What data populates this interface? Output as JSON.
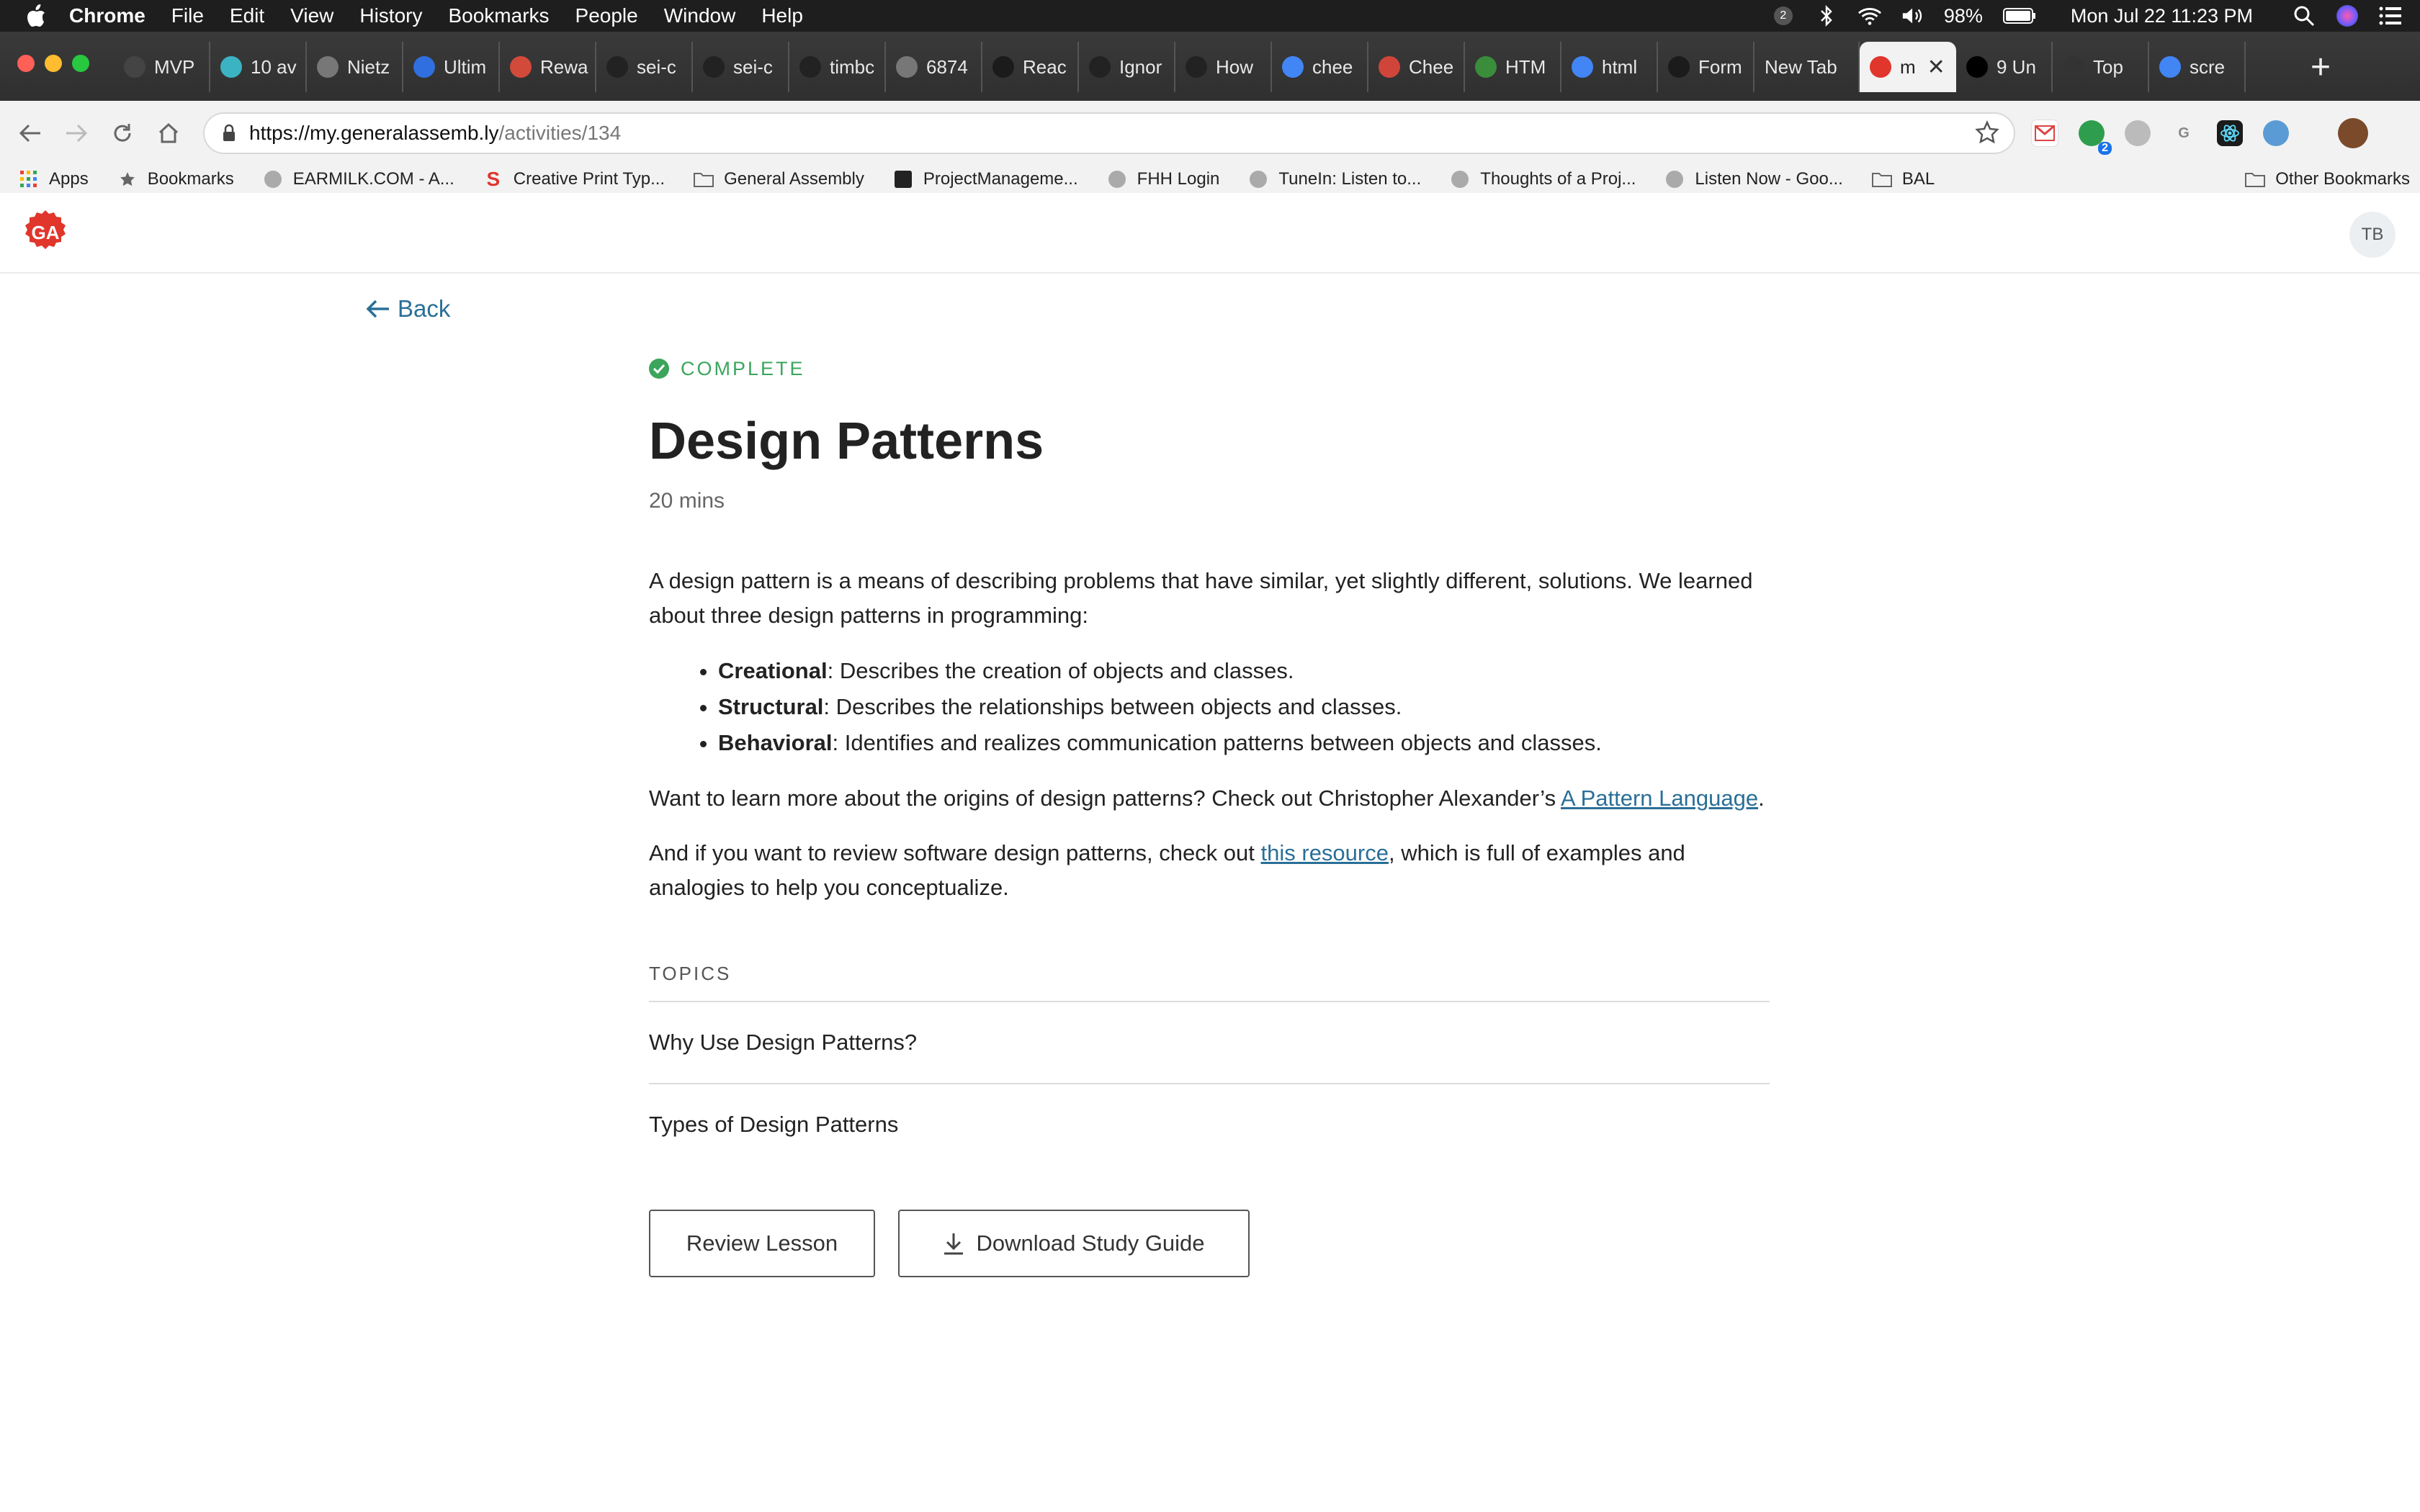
{
  "menubar": {
    "items": [
      "Chrome",
      "File",
      "Edit",
      "View",
      "History",
      "Bookmarks",
      "People",
      "Window",
      "Help"
    ],
    "battery": "98%",
    "clock": "Mon Jul 22  11:23 PM",
    "notif_count": "2"
  },
  "tabs": [
    {
      "label": "MVP",
      "icon": "smiley-icon",
      "color": "#444"
    },
    {
      "label": "10 av",
      "icon": "teal-circle-icon",
      "color": "#3bb3c3"
    },
    {
      "label": "Nietz",
      "icon": "globe-icon",
      "color": "#777"
    },
    {
      "label": "Ultim",
      "icon": "blue-circle-icon",
      "color": "#2f6fe0"
    },
    {
      "label": "Rewa",
      "icon": "trello-icon",
      "color": "#d24a3a"
    },
    {
      "label": "sei-c",
      "icon": "github-icon",
      "color": "#222"
    },
    {
      "label": "sei-c",
      "icon": "github-icon",
      "color": "#222"
    },
    {
      "label": "timbc",
      "icon": "github-icon",
      "color": "#222"
    },
    {
      "label": "6874",
      "icon": "globe-icon",
      "color": "#777"
    },
    {
      "label": "Reac",
      "icon": "react-icon",
      "color": "#1b1b1b"
    },
    {
      "label": "Ignor",
      "icon": "github-icon",
      "color": "#222"
    },
    {
      "label": "How",
      "icon": "github-icon",
      "color": "#222"
    },
    {
      "label": "chee",
      "icon": "google-icon",
      "color": "#4285f4"
    },
    {
      "label": "Chee",
      "icon": "stripes-icon",
      "color": "#d0453a"
    },
    {
      "label": "HTM",
      "icon": "w3-icon",
      "color": "#3a8d3a"
    },
    {
      "label": "html",
      "icon": "google-icon",
      "color": "#4285f4"
    },
    {
      "label": "Form",
      "icon": "react-icon",
      "color": "#1b1b1b"
    },
    {
      "label": "New Tab",
      "icon": "",
      "color": ""
    },
    {
      "label": "m",
      "icon": "ga-icon",
      "color": "#e0362c",
      "active": true
    },
    {
      "label": "9 Un",
      "icon": "dev-icon",
      "color": "#000"
    },
    {
      "label": "Top",
      "icon": "round-icon",
      "color": "#333"
    },
    {
      "label": "scre",
      "icon": "google-icon",
      "color": "#4285f4"
    }
  ],
  "address": {
    "host": "https://my.generalassemb.ly",
    "path": "/activities/134"
  },
  "bookmarks": [
    {
      "label": "Apps",
      "icon": "apps-grid-icon"
    },
    {
      "label": "Bookmarks",
      "icon": "star-icon"
    },
    {
      "label": "EARMILK.COM - A...",
      "icon": "globe-icon"
    },
    {
      "label": "Creative Print Typ...",
      "icon": "s-logo-icon"
    },
    {
      "label": "General Assembly",
      "icon": "folder-icon"
    },
    {
      "label": "ProjectManageme...",
      "icon": "pm-icon"
    },
    {
      "label": "FHH Login",
      "icon": "globe-icon"
    },
    {
      "label": "TuneIn: Listen to...",
      "icon": "globe-icon"
    },
    {
      "label": "Thoughts of a Proj...",
      "icon": "globe-icon"
    },
    {
      "label": "Listen Now - Goo...",
      "icon": "play-circle-icon"
    },
    {
      "label": "BAL",
      "icon": "folder-icon"
    }
  ],
  "other_bookmarks": "Other Bookmarks",
  "user": {
    "initials": "TB"
  },
  "back_label": "Back",
  "lesson": {
    "status": "COMPLETE",
    "title": "Design Patterns",
    "duration": "20 mins",
    "intro": "A design pattern is a means of describing problems that have similar, yet slightly different, solutions. We learned about three design patterns in programming:",
    "patterns": [
      {
        "name": "Creational",
        "desc": ": Describes the creation of objects and classes."
      },
      {
        "name": "Structural",
        "desc": ": Describes the relationships between objects and classes."
      },
      {
        "name": "Behavioral",
        "desc": ": Identifies and realizes communication patterns between objects and classes."
      }
    ],
    "origins_text": "Want to learn more about the origins of design patterns? Check out Christopher Alexander’s ",
    "origins_link": "A Pattern Language",
    "origins_end": ".",
    "review_text": "And if you want to review software design patterns, check out ",
    "review_link": "this resource",
    "review_end": ", which is full of examples and analogies to help you conceptualize."
  },
  "topics": {
    "label": "TOPICS",
    "items": [
      "Why Use Design Patterns?",
      "Types of Design Patterns"
    ]
  },
  "buttons": {
    "review": "Review Lesson",
    "download": "Download Study Guide"
  },
  "colors": {
    "accent_link": "#2a6f97",
    "complete_green": "#3ba55c",
    "ga_red": "#e0362c"
  }
}
